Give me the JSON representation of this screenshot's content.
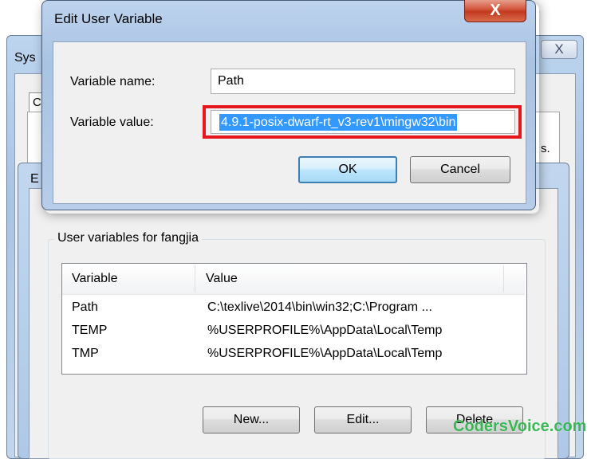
{
  "system_properties": {
    "title": "Sys",
    "close_glyph": "X",
    "tab_label": "C",
    "truncated_text": "s."
  },
  "environment_variables": {
    "title": "E",
    "user_group_label": "User variables for fangjia",
    "columns": [
      "Variable",
      "Value"
    ],
    "rows": [
      {
        "variable": "Path",
        "value": "C:\\texlive\\2014\\bin\\win32;C:\\Program ..."
      },
      {
        "variable": "TEMP",
        "value": "%USERPROFILE%\\AppData\\Local\\Temp"
      },
      {
        "variable": "TMP",
        "value": "%USERPROFILE%\\AppData\\Local\\Temp"
      }
    ],
    "buttons": {
      "new": "New...",
      "edit": "Edit...",
      "delete": "Delete"
    }
  },
  "edit_dialog": {
    "title": "Edit User Variable",
    "close_glyph": "X",
    "name_label": "Variable name:",
    "name_value": "Path",
    "value_label": "Variable value:",
    "value_text": "4.9.1-posix-dwarf-rt_v3-rev1\\mingw32\\bin",
    "ok_label": "OK",
    "cancel_label": "Cancel"
  },
  "watermark": "CodersVoice.com",
  "colors": {
    "highlight_border": "#e5161d",
    "selection": "#3399ff",
    "watermark": "#2db34a"
  }
}
